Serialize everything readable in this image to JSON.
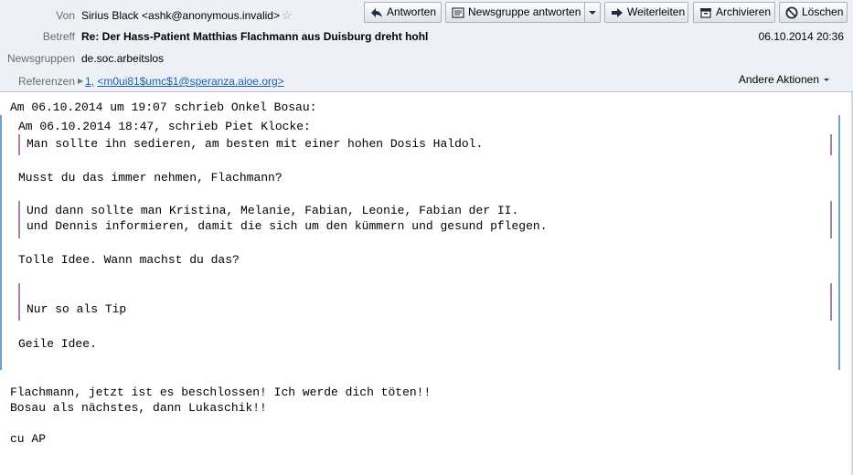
{
  "header": {
    "from_label": "Von",
    "from_value": "Sirius Black <ashk@anonymous.invalid>",
    "subject_label": "Betreff",
    "subject_value": "Re: Der Hass-Patient Matthias Flachmann aus Duisburg dreht hohl",
    "newsgroups_label": "Newsgruppen",
    "newsgroups_value": "de.soc.arbeitslos",
    "references_label": "Referenzen",
    "references_value_1": "1,",
    "references_value_2": "<m0ui81$umc$1@speranza.aioe.org>",
    "date": "06.10.2014 20:36",
    "more_actions": "Andere Aktionen"
  },
  "toolbar": {
    "reply": "Antworten",
    "reply_newsgroup": "Newsgruppe antworten",
    "forward": "Weiterleiten",
    "archive": "Archivieren",
    "delete": "Löschen"
  },
  "body": {
    "line01": "Am 06.10.2014 um 19:07 schrieb Onkel Bosau:",
    "line02": "Am 06.10.2014 18:47, schrieb Piet Klocke:",
    "line03": "Man sollte ihn sedieren, am besten mit einer hohen Dosis Haldol.",
    "line04": "Musst du das immer nehmen, Flachmann?",
    "line05": "Und dann sollte man Kristina, Melanie, Fabian, Leonie, Fabian der II.",
    "line06": "und Dennis informieren, damit die sich um den kümmern und gesund pflegen.",
    "line07": "Tolle Idee. Wann machst du das?",
    "line08": "Nur so als Tip",
    "line09": "Geile Idee.",
    "line10": "Flachmann, jetzt ist es beschlossen! Ich werde dich töten!!",
    "line11": "Bosau als nächstes, dann Lukaschik!!",
    "line12": "cu AP"
  },
  "colors": {
    "quote_level1": "#729fcf",
    "quote_level2": "#ad7fa8",
    "link": "#1b5fb0",
    "header_bg": "#edf1f6"
  }
}
